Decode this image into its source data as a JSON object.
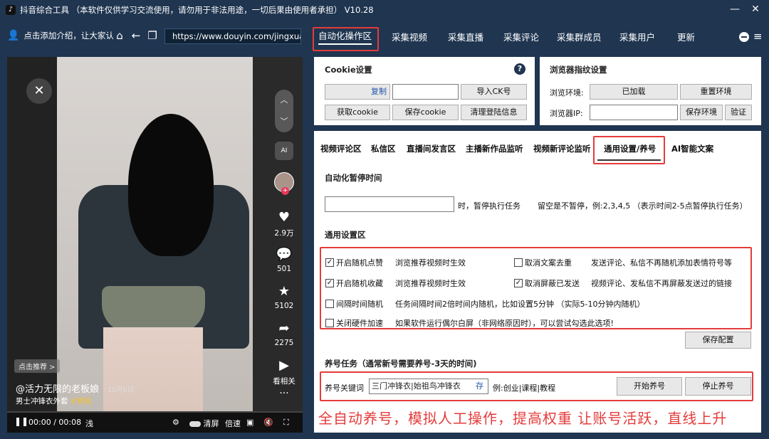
{
  "window": {
    "title": "抖音综合工具  （本软件仅供学习交流使用，请勿用于非法用途，一切后果由使用者承担）  V10.28",
    "icon": "tiktok-icon"
  },
  "nav": {
    "user_text": "点击添加介绍，让大家认",
    "url": "https://www.douyin.com/jingxuan",
    "tabs": [
      "自动化操作区",
      "采集视频",
      "采集直播",
      "采集评论",
      "采集群成员",
      "采集用户",
      "更新"
    ]
  },
  "video": {
    "counts": {
      "likes": "2.9万",
      "comments": "501",
      "favorites": "5102",
      "shares": "2275",
      "watch": "看相关"
    },
    "badge": "点击推荐 >",
    "author": "@活力无限的老板娘",
    "date": "· 10月6日",
    "desc": "男士冲锋衣外套",
    "tag": "#男装",
    "time": "00:00 / 00:08",
    "controls": [
      "浅",
      "清屏",
      "倍速"
    ]
  },
  "cookie": {
    "title": "Cookie设置",
    "copy": "复制",
    "import": "导入CK号",
    "get": "获取cookie",
    "save": "保存cookie",
    "clear": "清理登陆信息"
  },
  "browser": {
    "title": "浏览器指纹设置",
    "env_label": "浏览环境:",
    "env_value": "已加载",
    "reset": "重置环境",
    "ip_label": "浏览器IP:",
    "save_env": "保存环境",
    "verify": "验证"
  },
  "subtabs": [
    "视频评论区",
    "私信区",
    "直播间发言区",
    "主播新作品监听",
    "视频新评论监听",
    "通用设置/养号",
    "AI智能文案"
  ],
  "pause": {
    "title": "自动化暂停时间",
    "unit": "时，暂停执行任务",
    "hint": "留空是不暂停，例:2,3,4,5 （表示时间2-5点暂停执行任务）"
  },
  "general": {
    "title": "通用设置区",
    "rows": [
      {
        "label": "开启随机点赞",
        "checked": true,
        "note": "浏览推荐视频时生效"
      },
      {
        "label": "开启随机收藏",
        "checked": true,
        "note": "浏览推荐视频时生效"
      },
      {
        "label": "间隔时间随机",
        "checked": false,
        "note": "任务间隔时间2倍时间内随机，比如设置5分钟 （实际5-10分钟内随机）"
      },
      {
        "label": "关闭硬件加速",
        "checked": false,
        "note": "如果软件运行偶尔白屏（非网络原因时），可以尝试勾选此选项!"
      }
    ],
    "right_rows": [
      {
        "label": "取消文案去重",
        "checked": false,
        "note": "发送评论、私信不再随机添加表情符号等"
      },
      {
        "label": "取消屏蔽已发送",
        "checked": true,
        "note": "视频评论、发私信不再屏蔽发送过的链接"
      }
    ],
    "save": "保存配置"
  },
  "nurture": {
    "title": "养号任务（通常新号需要养号-3天的时间)",
    "kw_label": "养号关键词",
    "kw_value": "三门冲锋衣|始祖鸟冲锋衣",
    "save_small": "存",
    "example": "例:创业|课程|教程",
    "start": "开始养号",
    "stop": "停止养号"
  },
  "promo": "全自动养号，模拟人工操作，提高权重 让账号活跃，直线上升"
}
